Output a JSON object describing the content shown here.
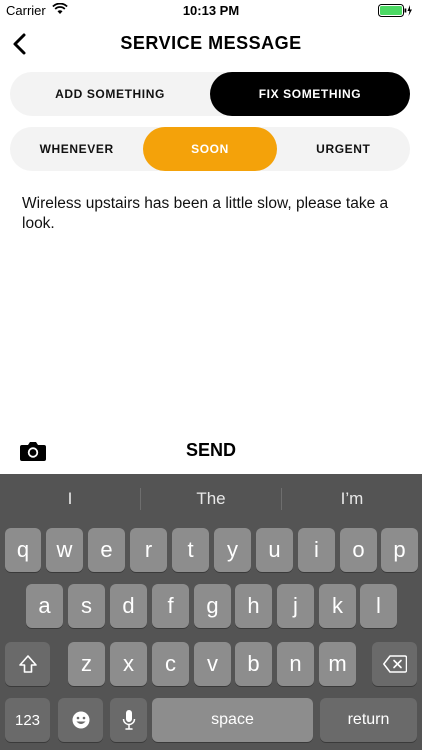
{
  "status": {
    "carrier": "Carrier",
    "time": "10:13 PM"
  },
  "header": {
    "title": "SERVICE MESSAGE"
  },
  "request_type": {
    "options": [
      "ADD SOMETHING",
      "FIX SOMETHING"
    ],
    "selected": "FIX SOMETHING"
  },
  "urgency": {
    "options": [
      "WHENEVER",
      "SOON",
      "URGENT"
    ],
    "selected": "SOON"
  },
  "message": {
    "text": "Wireless upstairs has been a little slow, please take a look."
  },
  "actions": {
    "send_label": "SEND"
  },
  "colors": {
    "accent": "#f4a20a",
    "selected_dark": "#000000",
    "keyboard_bg": "#545454",
    "battery": "#4cd964"
  },
  "keyboard": {
    "suggestions": [
      "I",
      "The",
      "I’m"
    ],
    "row1": [
      "q",
      "w",
      "e",
      "r",
      "t",
      "y",
      "u",
      "i",
      "o",
      "p"
    ],
    "row2": [
      "a",
      "s",
      "d",
      "f",
      "g",
      "h",
      "j",
      "k",
      "l"
    ],
    "row3": [
      "z",
      "x",
      "c",
      "v",
      "b",
      "n",
      "m"
    ],
    "numbers_label": "123",
    "space_label": "space",
    "return_label": "return"
  }
}
